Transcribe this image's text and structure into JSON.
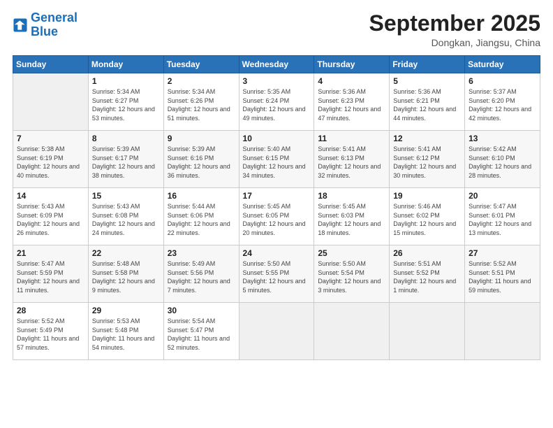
{
  "header": {
    "logo_general": "General",
    "logo_blue": "Blue",
    "month_title": "September 2025",
    "location": "Dongkan, Jiangsu, China"
  },
  "calendar": {
    "days_of_week": [
      "Sunday",
      "Monday",
      "Tuesday",
      "Wednesday",
      "Thursday",
      "Friday",
      "Saturday"
    ],
    "weeks": [
      [
        {
          "day": "",
          "info": ""
        },
        {
          "day": "1",
          "info": "Sunrise: 5:34 AM\nSunset: 6:27 PM\nDaylight: 12 hours\nand 53 minutes."
        },
        {
          "day": "2",
          "info": "Sunrise: 5:34 AM\nSunset: 6:26 PM\nDaylight: 12 hours\nand 51 minutes."
        },
        {
          "day": "3",
          "info": "Sunrise: 5:35 AM\nSunset: 6:24 PM\nDaylight: 12 hours\nand 49 minutes."
        },
        {
          "day": "4",
          "info": "Sunrise: 5:36 AM\nSunset: 6:23 PM\nDaylight: 12 hours\nand 47 minutes."
        },
        {
          "day": "5",
          "info": "Sunrise: 5:36 AM\nSunset: 6:21 PM\nDaylight: 12 hours\nand 44 minutes."
        },
        {
          "day": "6",
          "info": "Sunrise: 5:37 AM\nSunset: 6:20 PM\nDaylight: 12 hours\nand 42 minutes."
        }
      ],
      [
        {
          "day": "7",
          "info": "Sunrise: 5:38 AM\nSunset: 6:19 PM\nDaylight: 12 hours\nand 40 minutes."
        },
        {
          "day": "8",
          "info": "Sunrise: 5:39 AM\nSunset: 6:17 PM\nDaylight: 12 hours\nand 38 minutes."
        },
        {
          "day": "9",
          "info": "Sunrise: 5:39 AM\nSunset: 6:16 PM\nDaylight: 12 hours\nand 36 minutes."
        },
        {
          "day": "10",
          "info": "Sunrise: 5:40 AM\nSunset: 6:15 PM\nDaylight: 12 hours\nand 34 minutes."
        },
        {
          "day": "11",
          "info": "Sunrise: 5:41 AM\nSunset: 6:13 PM\nDaylight: 12 hours\nand 32 minutes."
        },
        {
          "day": "12",
          "info": "Sunrise: 5:41 AM\nSunset: 6:12 PM\nDaylight: 12 hours\nand 30 minutes."
        },
        {
          "day": "13",
          "info": "Sunrise: 5:42 AM\nSunset: 6:10 PM\nDaylight: 12 hours\nand 28 minutes."
        }
      ],
      [
        {
          "day": "14",
          "info": "Sunrise: 5:43 AM\nSunset: 6:09 PM\nDaylight: 12 hours\nand 26 minutes."
        },
        {
          "day": "15",
          "info": "Sunrise: 5:43 AM\nSunset: 6:08 PM\nDaylight: 12 hours\nand 24 minutes."
        },
        {
          "day": "16",
          "info": "Sunrise: 5:44 AM\nSunset: 6:06 PM\nDaylight: 12 hours\nand 22 minutes."
        },
        {
          "day": "17",
          "info": "Sunrise: 5:45 AM\nSunset: 6:05 PM\nDaylight: 12 hours\nand 20 minutes."
        },
        {
          "day": "18",
          "info": "Sunrise: 5:45 AM\nSunset: 6:03 PM\nDaylight: 12 hours\nand 18 minutes."
        },
        {
          "day": "19",
          "info": "Sunrise: 5:46 AM\nSunset: 6:02 PM\nDaylight: 12 hours\nand 15 minutes."
        },
        {
          "day": "20",
          "info": "Sunrise: 5:47 AM\nSunset: 6:01 PM\nDaylight: 12 hours\nand 13 minutes."
        }
      ],
      [
        {
          "day": "21",
          "info": "Sunrise: 5:47 AM\nSunset: 5:59 PM\nDaylight: 12 hours\nand 11 minutes."
        },
        {
          "day": "22",
          "info": "Sunrise: 5:48 AM\nSunset: 5:58 PM\nDaylight: 12 hours\nand 9 minutes."
        },
        {
          "day": "23",
          "info": "Sunrise: 5:49 AM\nSunset: 5:56 PM\nDaylight: 12 hours\nand 7 minutes."
        },
        {
          "day": "24",
          "info": "Sunrise: 5:50 AM\nSunset: 5:55 PM\nDaylight: 12 hours\nand 5 minutes."
        },
        {
          "day": "25",
          "info": "Sunrise: 5:50 AM\nSunset: 5:54 PM\nDaylight: 12 hours\nand 3 minutes."
        },
        {
          "day": "26",
          "info": "Sunrise: 5:51 AM\nSunset: 5:52 PM\nDaylight: 12 hours\nand 1 minute."
        },
        {
          "day": "27",
          "info": "Sunrise: 5:52 AM\nSunset: 5:51 PM\nDaylight: 11 hours\nand 59 minutes."
        }
      ],
      [
        {
          "day": "28",
          "info": "Sunrise: 5:52 AM\nSunset: 5:49 PM\nDaylight: 11 hours\nand 57 minutes."
        },
        {
          "day": "29",
          "info": "Sunrise: 5:53 AM\nSunset: 5:48 PM\nDaylight: 11 hours\nand 54 minutes."
        },
        {
          "day": "30",
          "info": "Sunrise: 5:54 AM\nSunset: 5:47 PM\nDaylight: 11 hours\nand 52 minutes."
        },
        {
          "day": "",
          "info": ""
        },
        {
          "day": "",
          "info": ""
        },
        {
          "day": "",
          "info": ""
        },
        {
          "day": "",
          "info": ""
        }
      ]
    ]
  }
}
